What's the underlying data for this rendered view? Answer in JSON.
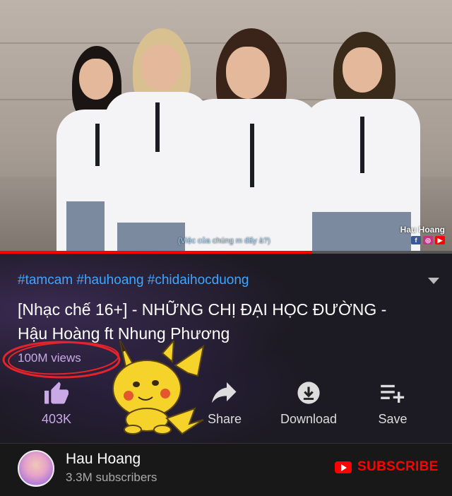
{
  "video": {
    "watermark": "Hau Hoang",
    "caption": "(Việc của chúng m đấy à?)",
    "progress": 0.69
  },
  "info": {
    "hashtags": "#tamcam #hauhoang #chidaihocduong",
    "title": "[Nhạc chế 16+] - NHỮNG CHỊ ĐẠI HỌC ĐƯỜNG - Hậu Hoàng ft Nhung Phương",
    "views": "100M views"
  },
  "actions": {
    "like_count": "403K",
    "share_label": "Share",
    "download_label": "Download",
    "save_label": "Save"
  },
  "channel": {
    "name": "Hau Hoang",
    "subscribers": "3.3M subscribers",
    "subscribe_label": "SUBSCRIBE"
  },
  "colors": {
    "accent_red": "#ff0000",
    "hashtag_blue": "#3ea6ff",
    "views_purple": "#c9a9e6"
  }
}
